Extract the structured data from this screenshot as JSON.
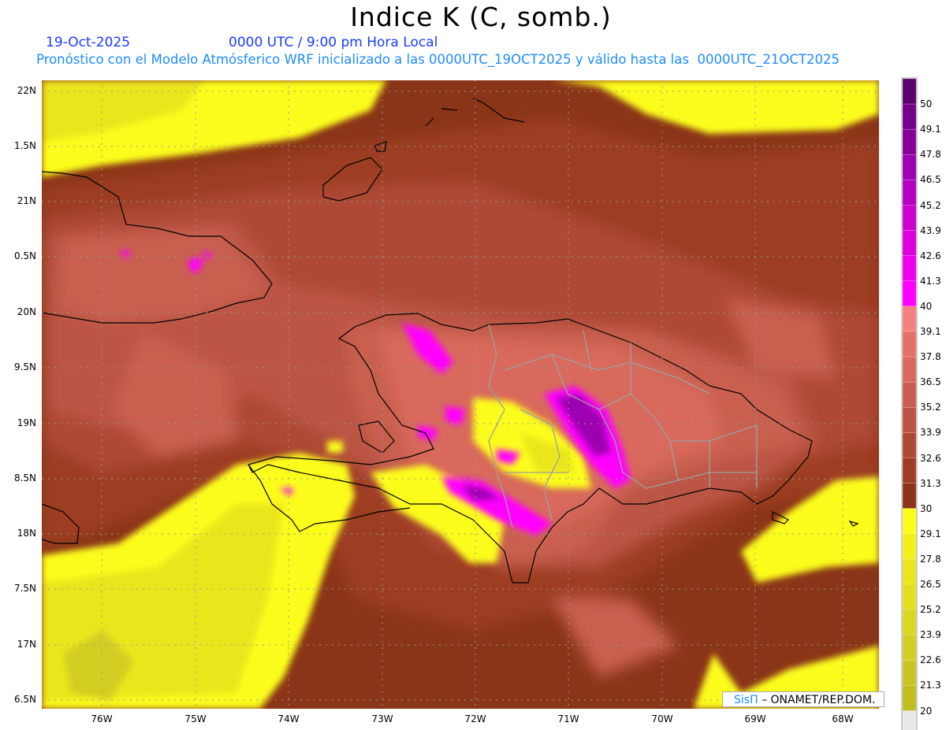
{
  "title": "Indice K (C, somb.)",
  "date": "19-Oct-2025",
  "time": "0000 UTC / 9:00 pm Hora Local",
  "description": "Pronóstico con el Modelo Atmósferico WRF inicializado a las 0000UTC_19OCT2025 y válido hasta las  0000UTC_21OCT2025",
  "lat_labels": [
    "22N",
    "1.5N",
    "21N",
    "0.5N",
    "20N",
    "9.5N",
    "19N",
    "8.5N",
    "18N",
    "7.5N",
    "17N",
    "6.5N"
  ],
  "lon_labels": [
    "76W",
    "75W",
    "74W",
    "73W",
    "72W",
    "71W",
    "70W",
    "69W",
    "68W"
  ],
  "colorbar": {
    "labels": [
      "50",
      "49.1",
      "47.8",
      "46.5",
      "45.2",
      "43.9",
      "42.6",
      "41.3",
      "40",
      "39.1",
      "37.8",
      "36.5",
      "35.2",
      "33.9",
      "32.6",
      "31.3",
      "30",
      "29.1",
      "27.8",
      "26.5",
      "25.2",
      "23.9",
      "22.6",
      "21.3",
      "20"
    ],
    "colors": [
      "#5c006c",
      "#720088",
      "#860098",
      "#9c00b0",
      "#b400c0",
      "#cc00cc",
      "#dd00dd",
      "#ee00ee",
      "#ff00ff",
      "#f58080",
      "#e57068",
      "#d8695c",
      "#c95e50",
      "#bb5444",
      "#ad4a34",
      "#9d3d24",
      "#8b3518",
      "#fcfc1a",
      "#f3ef1a",
      "#ebe61c",
      "#e3de1e",
      "#dbd620",
      "#d3ce22",
      "#cac522",
      "#c2bd1f",
      "#e8e8e8"
    ]
  },
  "credit": {
    "brand": "SisΠ",
    "text": "– ONAMET/REP.DOM."
  }
}
